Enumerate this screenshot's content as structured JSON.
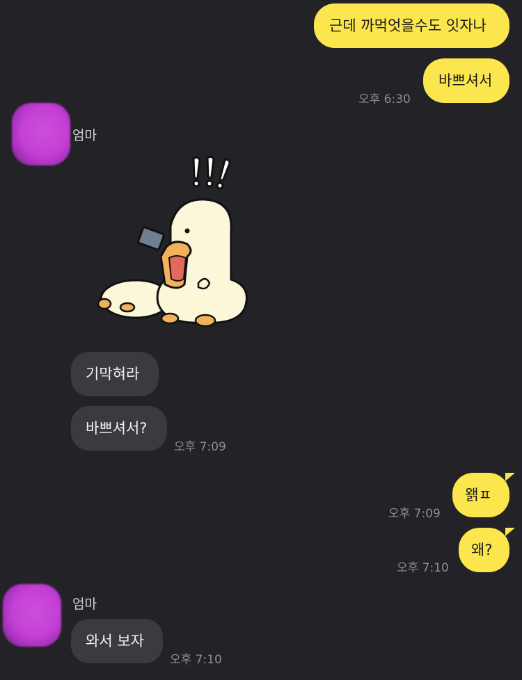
{
  "messages": {
    "m1": {
      "text": "근데 까먹엇을수도 잇자나"
    },
    "m2": {
      "text": "바쁘셔서",
      "time": "오후 6:30"
    },
    "sender1": {
      "name": "엄마"
    },
    "m3": {
      "text": "기막혀라"
    },
    "m4": {
      "text": "바쁘셔서?",
      "time": "오후 7:09"
    },
    "m5": {
      "text": "왥ㅍ",
      "time": "오후 7:09"
    },
    "m6": {
      "text": "왜?",
      "time": "오후 7:10"
    },
    "sender2": {
      "name": "엄마"
    },
    "m7": {
      "text": "와서 보자",
      "time": "오후 7:10"
    }
  },
  "colors": {
    "background": "#232226",
    "outgoing_bubble": "#fbe64d",
    "incoming_bubble": "#3b3a3f",
    "avatar": "#c53fd6"
  },
  "icons": {
    "sticker": "duck-sticker-shocked"
  }
}
